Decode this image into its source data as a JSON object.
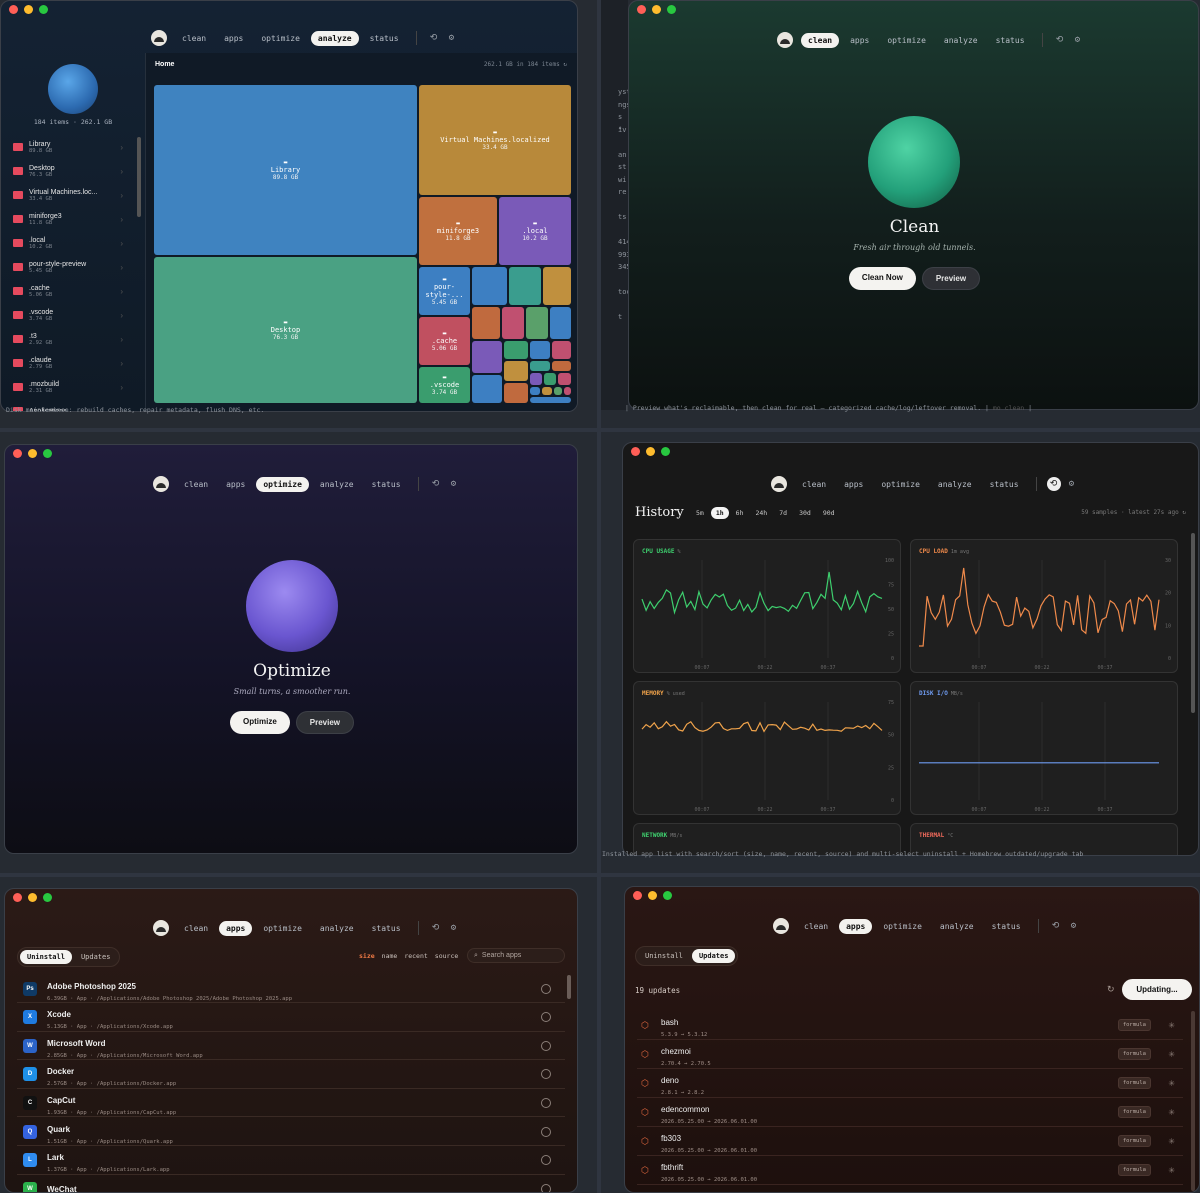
{
  "nav": {
    "tabs": [
      "clean",
      "apps",
      "optimize",
      "analyze",
      "status"
    ]
  },
  "analyze": {
    "summary": "184 items · 262.1 GB",
    "breadcrumb": "Home",
    "header_right": "262.1 GB in 184 items",
    "sidebar": [
      {
        "name": "Library",
        "size": "89.8 GB"
      },
      {
        "name": "Desktop",
        "size": "76.3 GB"
      },
      {
        "name": "Virtual Machines.loc...",
        "size": "33.4 GB"
      },
      {
        "name": "miniforge3",
        "size": "11.8 GB"
      },
      {
        "name": ".local",
        "size": "10.2 GB"
      },
      {
        "name": "pour-style-preview",
        "size": "5.45 GB"
      },
      {
        "name": ".cache",
        "size": "5.06 GB"
      },
      {
        "name": ".vscode",
        "size": "3.74 GB"
      },
      {
        "name": ".t3",
        "size": "2.92 GB"
      },
      {
        "name": ".claude",
        "size": "2.79 GB"
      },
      {
        "name": ".mozbuild",
        "size": "2.31 GB"
      },
      {
        "name": "Applications",
        "size": ""
      }
    ],
    "tiles": [
      {
        "name": "Library",
        "size": "89.8 GB"
      },
      {
        "name": "Virtual Machines.localized",
        "size": "33.4 GB"
      },
      {
        "name": "miniforge3",
        "size": "11.8 GB"
      },
      {
        "name": ".local",
        "size": "10.2 GB"
      },
      {
        "name": "Desktop",
        "size": "76.3 GB"
      },
      {
        "name": "pour-style-...",
        "size": "5.45 GB"
      },
      {
        "name": ".cache",
        "size": "5.06 GB"
      },
      {
        "name": ".vscode",
        "size": "3.74 GB"
      }
    ],
    "bottom_text": "Disk maintenance: rebuild caches, repair metadata, flush DNS, etc."
  },
  "clean": {
    "title": "Clean",
    "subtitle": "Fresh air through old tunnels.",
    "primary": "Clean Now",
    "secondary": "Preview",
    "bottom_text": "Preview what's reclaimable, then clean for real — categorized cache/log/leftover removal.",
    "bottom_badge": "mo clean"
  },
  "optimize": {
    "title": "Optimize",
    "subtitle": "Small turns, a smoother run.",
    "primary": "Optimize",
    "secondary": "Preview"
  },
  "history": {
    "title": "History",
    "ranges": [
      "5m",
      "1h",
      "6h",
      "24h",
      "7d",
      "30d",
      "90d"
    ],
    "active_range": "1h",
    "meta": "59 samples · latest 27s ago",
    "charts": [
      {
        "title": "CPU USAGE",
        "unit": "%",
        "color": "#3ecf6e",
        "yticks": [
          "100",
          "75",
          "50",
          "25",
          "0"
        ],
        "xticks": [
          "00:07",
          "00:22",
          "00:37"
        ]
      },
      {
        "title": "CPU LOAD",
        "unit": "1m avg",
        "color": "#f08a4b",
        "yticks": [
          "30",
          "20",
          "10",
          "0"
        ],
        "xticks": [
          "00:07",
          "00:22",
          "00:37"
        ]
      },
      {
        "title": "MEMORY",
        "unit": "% used",
        "color": "#f0a34b",
        "yticks": [
          "75",
          "50",
          "25",
          "0"
        ],
        "xticks": [
          "00:07",
          "00:22",
          "00:37"
        ]
      },
      {
        "title": "DISK I/O",
        "unit": "MB/s",
        "color": "#6f9bf0",
        "yticks": [],
        "xticks": [
          "00:07",
          "00:22",
          "00:37"
        ]
      },
      {
        "title": "NETWORK",
        "unit": "MB/s",
        "color": "#3ecf6e",
        "yticks": [],
        "xticks": []
      },
      {
        "title": "THERMAL",
        "unit": "°C",
        "color": "#f06a5b",
        "yticks": [],
        "xticks": []
      }
    ]
  },
  "uninstall": {
    "tabs": [
      "Uninstall",
      "Updates"
    ],
    "sort": [
      "size",
      "name",
      "recent",
      "source"
    ],
    "search_placeholder": "Search apps",
    "apps": [
      {
        "name": "Adobe Photoshop 2025",
        "meta": "6.39GB · App · /Applications/Adobe Photoshop 2025/Adobe Photoshop 2025.app",
        "icon": "Ps",
        "color": "#0f3a66"
      },
      {
        "name": "Xcode",
        "meta": "5.13GB · App · /Applications/Xcode.app",
        "icon": "X",
        "color": "#1f7be0"
      },
      {
        "name": "Microsoft Word",
        "meta": "2.85GB · App · /Applications/Microsoft Word.app",
        "icon": "W",
        "color": "#2b63c7"
      },
      {
        "name": "Docker",
        "meta": "2.57GB · App · /Applications/Docker.app",
        "icon": "D",
        "color": "#1e90e8"
      },
      {
        "name": "CapCut",
        "meta": "1.93GB · App · /Applications/CapCut.app",
        "icon": "C",
        "color": "#111111"
      },
      {
        "name": "Quark",
        "meta": "1.51GB · App · /Applications/Quark.app",
        "icon": "Q",
        "color": "#3463e0"
      },
      {
        "name": "Lark",
        "meta": "1.37GB · App · /Applications/Lark.app",
        "icon": "L",
        "color": "#2f8cf0"
      },
      {
        "name": "WeChat",
        "meta": "",
        "icon": "W",
        "color": "#2bb24c"
      }
    ],
    "bottom_text": "Installed app list with search/sort (size, name, recent, source) and multi-select uninstall + Homebrew outdated/upgrade tab"
  },
  "updates": {
    "tabs": [
      "Uninstall",
      "Updates"
    ],
    "count": "19 updates",
    "button": "Updating...",
    "items": [
      {
        "name": "bash",
        "ver": "5.3.9 → 5.3.12",
        "badge": "formula"
      },
      {
        "name": "chezmoi",
        "ver": "2.70.4 → 2.70.5",
        "badge": "formula"
      },
      {
        "name": "deno",
        "ver": "2.8.1 → 2.8.2",
        "badge": "formula"
      },
      {
        "name": "edencommon",
        "ver": "2026.05.25.00 → 2026.06.01.00",
        "badge": "formula"
      },
      {
        "name": "fb303",
        "ver": "2026.05.25.00 → 2026.06.01.00",
        "badge": "formula"
      },
      {
        "name": "fbthrift",
        "ver": "2026.05.25.00 → 2026.06.01.00",
        "badge": "formula"
      }
    ]
  },
  "terminal": {
    "lines_left_clean": [
      "yst",
      "ngs",
      "s i",
      "\"v",
      "",
      "an",
      "st",
      "wi",
      "re",
      "",
      "ts",
      "",
      "414",
      "993",
      "345",
      "",
      "toc",
      "",
      "t"
    ]
  }
}
